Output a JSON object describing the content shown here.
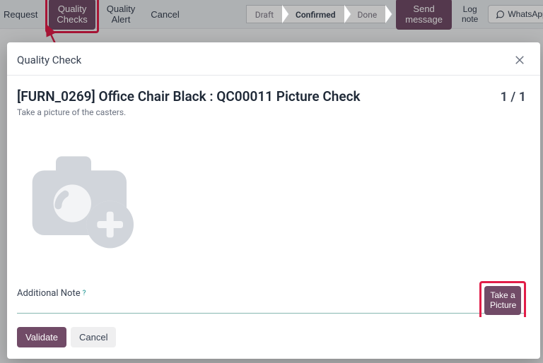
{
  "toolbar": {
    "request": "Request",
    "quality_checks": "Quality Checks",
    "quality_alert": "Quality Alert",
    "cancel": "Cancel",
    "stages": {
      "draft": "Draft",
      "confirmed": "Confirmed",
      "done": "Done"
    },
    "send_message": "Send message",
    "log_note": "Log note",
    "whatsapp": "WhatsApp"
  },
  "modal": {
    "title": "Quality Check",
    "check_title": "[FURN_0269] Office Chair Black : QC00011 Picture Check",
    "counter": "1 / 1",
    "subtitle": "Take a picture of the casters.",
    "field_label": "Additional Note",
    "take_picture": "Take a Picture",
    "validate": "Validate",
    "cancel": "Cancel"
  }
}
